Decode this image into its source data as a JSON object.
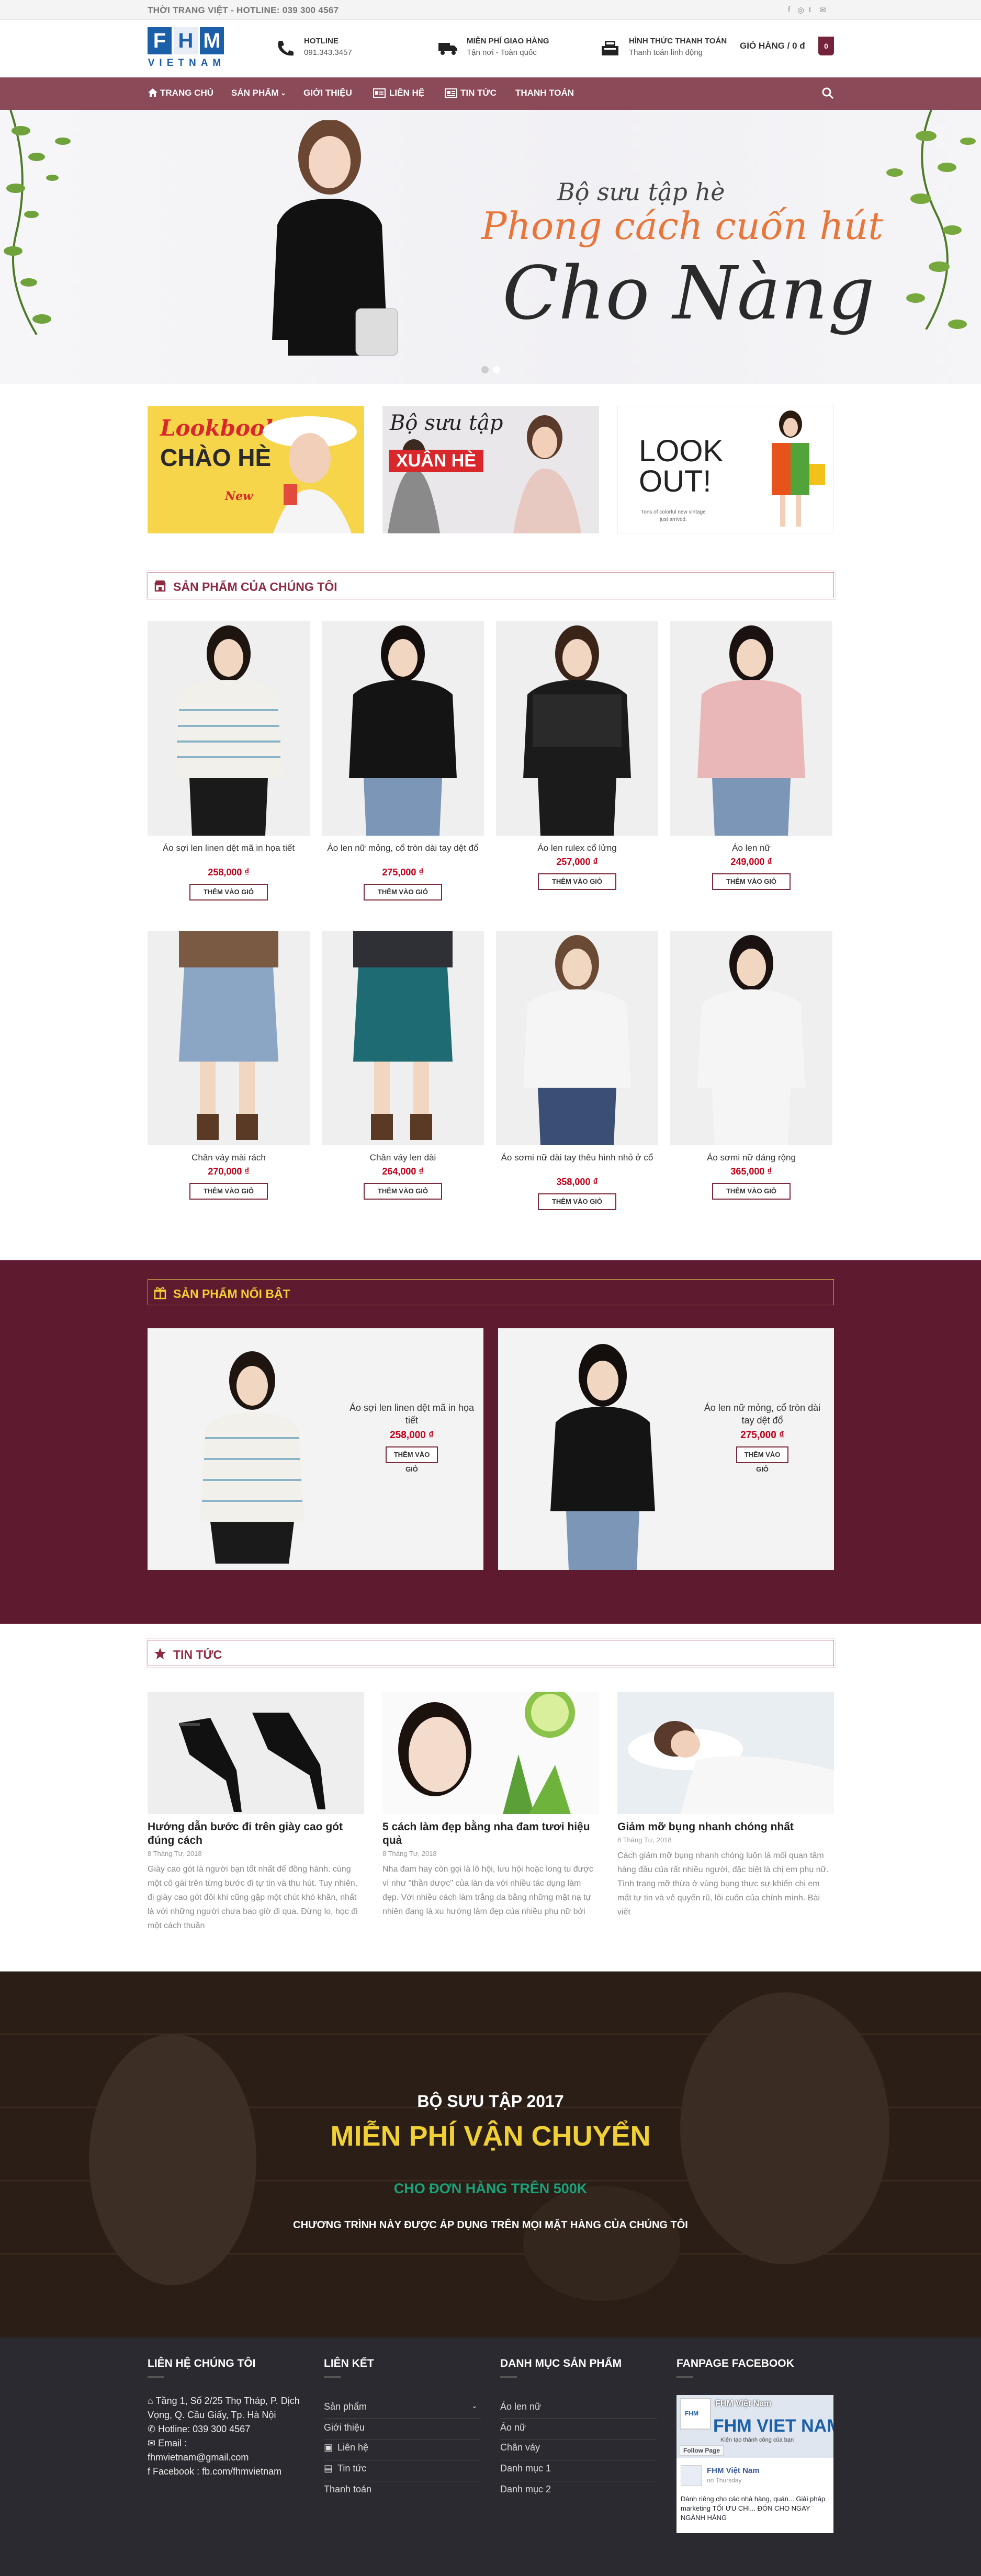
{
  "topbar": {
    "text": "THỜI TRANG VIỆT - HOTLINE: 039 300 4567"
  },
  "logo": {
    "letters": [
      "F",
      "H",
      "M"
    ],
    "sub": "VIETNAM"
  },
  "header": {
    "hotline": {
      "title": "HOTLINE",
      "value": "091.343.3457"
    },
    "shipping": {
      "title": "MIỄN PHÍ GIAO HÀNG",
      "value": "Tận nơi - Toàn quốc"
    },
    "payment": {
      "title": "HÌNH THỨC THANH TOÁN",
      "value": "Thanh toán linh động"
    },
    "cart_label": "GIỎ HÀNG / 0 đ",
    "cart_count": "0"
  },
  "nav": {
    "home": "TRANG CHỦ",
    "products": "SẢN PHẨM",
    "about": "GIỚI THIỆU",
    "contact": "LIÊN HỆ",
    "news": "TIN TỨC",
    "payment": "THANH TOÁN"
  },
  "hero": {
    "line1": "Bộ sưu tập hè",
    "line2": "Phong cách cuốn hút",
    "line3": "Cho Nàng"
  },
  "promos": {
    "p1": {
      "line1": "Lookbook",
      "line2": "CHÀO HÈ",
      "tag": "New"
    },
    "p2": {
      "line1": "Bộ sưu tập",
      "line2": "XUÂN HÈ"
    },
    "p3": {
      "line1": "LOOK",
      "line2": "OUT!",
      "small": "Tons of colorful new vintage just arrived."
    }
  },
  "section_products": {
    "title": "SẢN PHẨM CỦA CHÚNG TÔI"
  },
  "add_to_cart": "THÊM VÀO GIỎ",
  "products": [
    {
      "name": "Áo sợi len linen dệt mã in họa tiết",
      "price": "258,000 ₫"
    },
    {
      "name": "Áo len nữ mỏng, cổ tròn dài tay dệt đổ",
      "price": "275,000 ₫"
    },
    {
      "name": "Áo len rulex cổ lửng",
      "price": "257,000 ₫"
    },
    {
      "name": "Áo len nữ",
      "price": "249,000 ₫"
    },
    {
      "name": "Chân váy mài rách",
      "price": "270,000 ₫"
    },
    {
      "name": "Chân váy len dài",
      "price": "264,000 ₫"
    },
    {
      "name": "Áo sơmi nữ dài tay thêu hình nhỏ ở cổ",
      "price": "358,000 ₫"
    },
    {
      "name": "Áo sơmi nữ dáng rộng",
      "price": "365,000 ₫"
    }
  ],
  "section_featured": {
    "title": "SẢN PHẨM NỔI BẬT"
  },
  "featured": [
    {
      "name": "Áo sợi len linen dệt mã in họa tiết",
      "price": "258,000 ₫"
    },
    {
      "name": "Áo len nữ mỏng, cổ tròn dài tay dệt đổ",
      "price": "275,000 ₫"
    }
  ],
  "section_news": {
    "title": "TIN TỨC"
  },
  "news": [
    {
      "title": "Hướng dẫn bước đi trên giày cao gót đúng cách",
      "date": "8 Tháng Tư, 2018",
      "excerpt": "Giày cao gót là người bạn tốt nhất để đồng hành. cùng một cô gái trên từng bước đi tự tin và thu hút. Tuy nhiên, đi giày cao gót đôi khi cũng gặp một chút khó khăn, nhất là với những người chưa bao giờ đi qua. Đừng lo, học đi một cách thuần"
    },
    {
      "title": "5 cách làm đẹp bằng nha đam tươi hiệu quả",
      "date": "8 Tháng Tư, 2018",
      "excerpt": "Nha đam hay còn gọi là lô hội, lưu hội hoặc long tu được ví như \"thần dược\" của làn da với nhiều tác dụng làm đẹp. Với nhiều cách làm trắng da bằng những mặt nạ tự nhiên đang là xu hướng làm đẹp của nhiều phụ nữ bởi"
    },
    {
      "title": "Giảm mỡ bụng nhanh chóng nhất",
      "date": "8 Tháng Tư, 2018",
      "excerpt": "Cách giảm mỡ bụng nhanh chóng luôn là mối quan tâm hàng đầu của rất nhiều người, đặc biệt là chị em phụ nữ. Tình trạng mỡ thừa ở vùng bụng thực sự khiến chị em mất tự tin và vẻ quyến rũ, lôi cuốn của chính mình. Bài viết"
    }
  ],
  "band": {
    "line1": "BỘ SƯU TẬP 2017",
    "line2": "MIỄN PHÍ VẬN CHUYỂN",
    "line3": "CHO ĐƠN HÀNG TRÊN 500K",
    "line4": "CHƯƠNG TRÌNH NÀY ĐƯỢC ÁP DỤNG TRÊN MỌI MẶT HÀNG CỦA CHÚNG TÔI"
  },
  "footer": {
    "contact": {
      "title": "LIÊN HỆ CHÚNG TÔI",
      "address": "Tầng 1, Số 2/25 Thọ Tháp, P. Dịch Vọng, Q. Cầu Giấy, Tp. Hà Nội",
      "hotline": "Hotline: 039 300 4567",
      "email_label": "Email :",
      "email": "fhmvietnam@gmail.com",
      "facebook": "Facebook : fb.com/fhmvietnam"
    },
    "links": {
      "title": "LIÊN KẾT",
      "items": [
        "Sản phẩm",
        "Giới thiệu",
        "Liên hệ",
        "Tin tức",
        "Thanh toán"
      ]
    },
    "categories": {
      "title": "DANH MỤC SẢN PHẨM",
      "items": [
        "Áo len nữ",
        "Áo nữ",
        "Chân váy",
        "Danh mục 1",
        "Danh mục 2"
      ]
    },
    "fanpage": {
      "title": "FANPAGE FACEBOOK",
      "page_name": "FHM Việt Nam",
      "cover_text": "FHM VIET NAM",
      "cover_sub": "Kiến tạo thành công của bạn",
      "follow": "Follow Page",
      "post_name": "FHM Việt Nam",
      "post_time": "on Thursday",
      "post_text": "Dành riêng cho các nhà hàng, quán... Giải pháp marketing TỐI ƯU CHI... ĐÓN CHO NGAY NGÀNH HÀNG"
    }
  },
  "colors": {
    "brand": "#74243a",
    "nav": "#8a4a58",
    "accent_title": "#8e2b43",
    "gold": "#f0d034",
    "green": "#1aa37a",
    "price": "#c0001a"
  }
}
